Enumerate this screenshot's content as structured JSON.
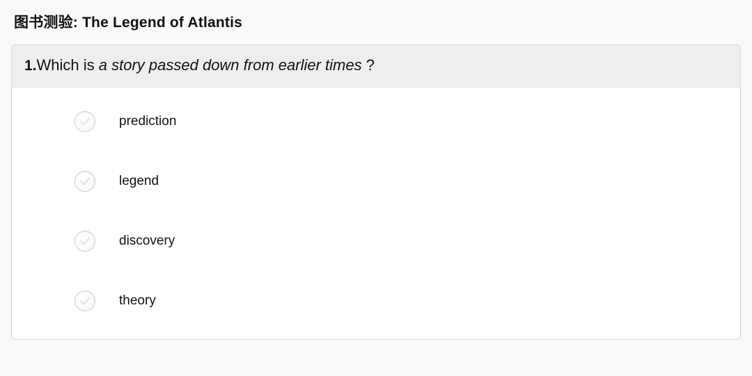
{
  "header": {
    "prefix": "图书测验: ",
    "title": "The Legend of Atlantis"
  },
  "question": {
    "number": "1.",
    "lead": "Which is ",
    "italic": "a story passed down from earlier times",
    "tail": " ?"
  },
  "options": [
    {
      "label": "prediction"
    },
    {
      "label": "legend"
    },
    {
      "label": "discovery"
    },
    {
      "label": "theory"
    }
  ]
}
